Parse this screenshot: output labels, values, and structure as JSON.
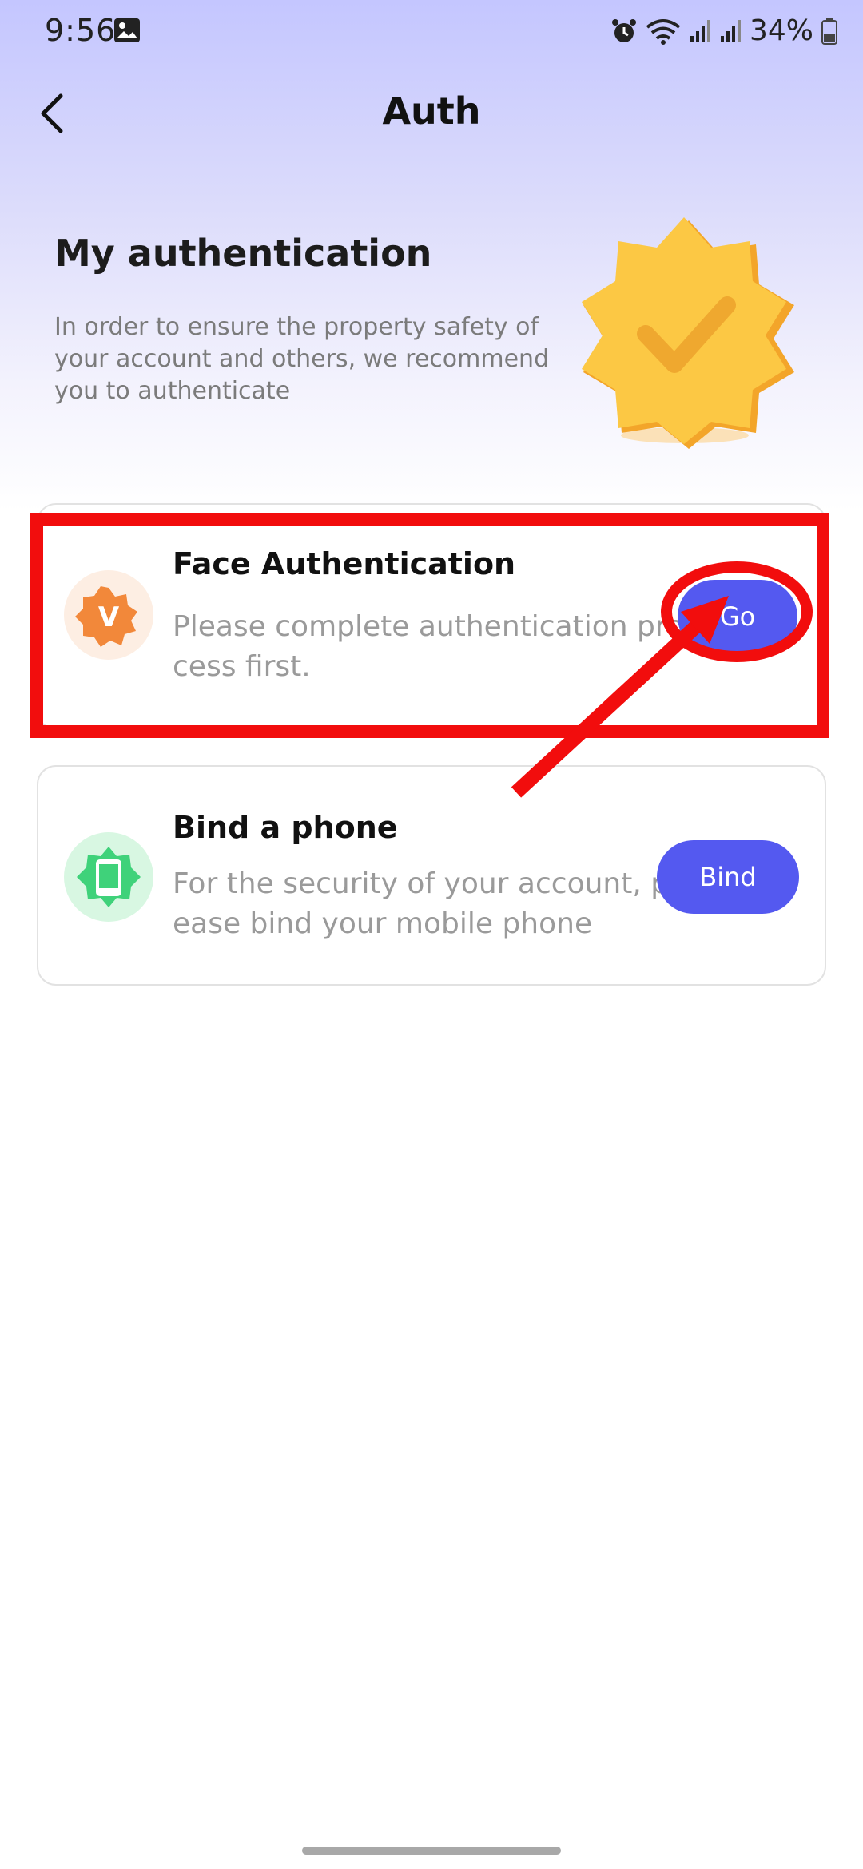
{
  "status_bar": {
    "time": "9:56",
    "battery": "34%",
    "icons": [
      "gallery-icon",
      "alarm-icon",
      "wifi-icon",
      "signal-icon",
      "signal-icon",
      "battery-icon"
    ]
  },
  "header": {
    "title": "Auth",
    "back_icon": "chevron-left-icon"
  },
  "hero": {
    "title": "My authentication",
    "description": "In order to ensure the property safety of your account and  others, we recommend you to authenticate",
    "badge_icon": "verified-badge-icon"
  },
  "cards": [
    {
      "title": "Face  Authentication",
      "description": "Please complete authentication process first.",
      "button": "Go",
      "icon": "verified-v-icon"
    },
    {
      "title": "Bind a phone",
      "description": "For the security of your account, please bind your mobile phone",
      "button": "Bind",
      "icon": "phone-icon"
    }
  ],
  "colors": {
    "accent": "#5459f0",
    "annotation": "#f20d0d",
    "badge": "#fbbf3a"
  }
}
